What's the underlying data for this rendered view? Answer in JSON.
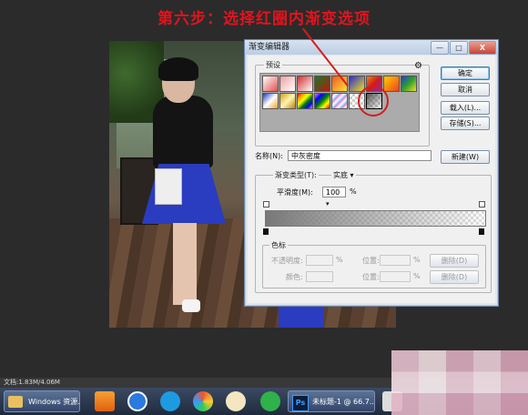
{
  "heading": "第六步：选择红圈内渐变选项",
  "dialog": {
    "title": "渐变编辑器",
    "window_buttons": {
      "minimize": "—",
      "maximize": "□",
      "close": "X"
    },
    "presets_label": "预设",
    "buttons": {
      "ok": "确定",
      "cancel": "取消",
      "load": "载入(L)...",
      "save": "存储(S)...",
      "new": "新建(W)"
    },
    "name_label": "名称(N):",
    "name_value": "中灰密度",
    "gradient_type_label": "渐变类型(T):",
    "gradient_type_value": "实底",
    "smoothness_label": "平滑度(M):",
    "smoothness_value": "100",
    "smoothness_unit": "%",
    "color_stops": {
      "label": "色标",
      "opacity_label": "不透明度:",
      "opacity_unit": "%",
      "location_label": "位置:",
      "location_unit": "%",
      "delete_label": "删除(D)",
      "color_label": "颜色:"
    }
  },
  "status_bar": {
    "doc_info": "文档:1.83M/4.06M"
  },
  "taskbar": {
    "items": [
      {
        "label": "Windows 资源..."
      },
      {
        "label": "未标题-1 @ 66.7..."
      }
    ]
  },
  "colors": {
    "annotation_red": "#d81b1b",
    "skirt_blue": "#2a3cc0"
  }
}
